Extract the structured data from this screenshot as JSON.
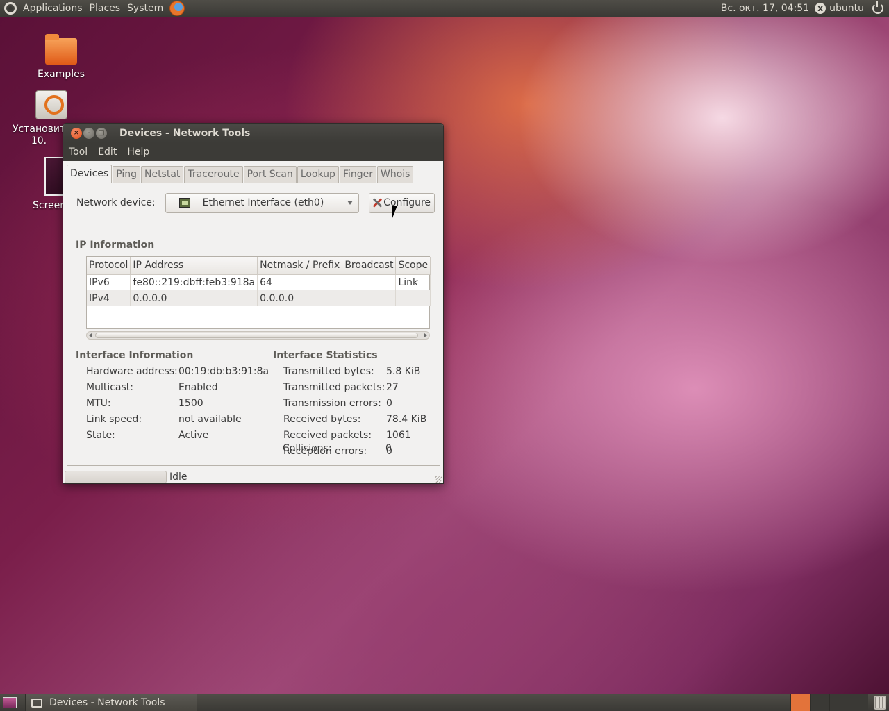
{
  "top_panel": {
    "menus": [
      "Applications",
      "Places",
      "System"
    ],
    "clock": "Вс. окт. 17, 04:51",
    "user": "ubuntu"
  },
  "desktop": {
    "icons": [
      {
        "label": "Examples"
      },
      {
        "label": "Установит 10."
      },
      {
        "label": "Screer"
      }
    ]
  },
  "window": {
    "title": "Devices - Network Tools",
    "menus": [
      "Tool",
      "Edit",
      "Help"
    ],
    "tabs": [
      "Devices",
      "Ping",
      "Netstat",
      "Traceroute",
      "Port Scan",
      "Lookup",
      "Finger",
      "Whois"
    ],
    "active_tab": "Devices",
    "device": {
      "label": "Network device:",
      "selected": "Ethernet Interface (eth0)",
      "configure_label": "Configure"
    },
    "ip_info": {
      "title": "IP Information",
      "columns": [
        "Protocol",
        "IP Address",
        "Netmask / Prefix",
        "Broadcast",
        "Scope"
      ],
      "rows": [
        [
          "IPv6",
          "fe80::219:dbff:feb3:918a",
          "64",
          "",
          "Link"
        ],
        [
          "IPv4",
          "0.0.0.0",
          "0.0.0.0",
          "",
          ""
        ]
      ]
    },
    "interface_info": {
      "title": "Interface Information",
      "items": [
        {
          "key": "Hardware address:",
          "value": "00:19:db:b3:91:8a"
        },
        {
          "key": "Multicast:",
          "value": "Enabled"
        },
        {
          "key": "MTU:",
          "value": "1500"
        },
        {
          "key": "Link speed:",
          "value": "not available"
        },
        {
          "key": "State:",
          "value": "Active"
        }
      ]
    },
    "interface_stats": {
      "title": "Interface Statistics",
      "items": [
        {
          "key": "Transmitted bytes:",
          "value": "5.8 KiB"
        },
        {
          "key": "Transmitted packets:",
          "value": "27"
        },
        {
          "key": "Transmission errors:",
          "value": "0"
        },
        {
          "key": "Received bytes:",
          "value": "78.4 KiB"
        },
        {
          "key": "Received packets:",
          "value": "1061"
        },
        {
          "key": "Reception errors:",
          "value": "0"
        },
        {
          "key": "Collisions:",
          "value": "0"
        }
      ]
    },
    "status": "Idle"
  },
  "bottom_panel": {
    "task_label": "Devices - Network Tools"
  }
}
